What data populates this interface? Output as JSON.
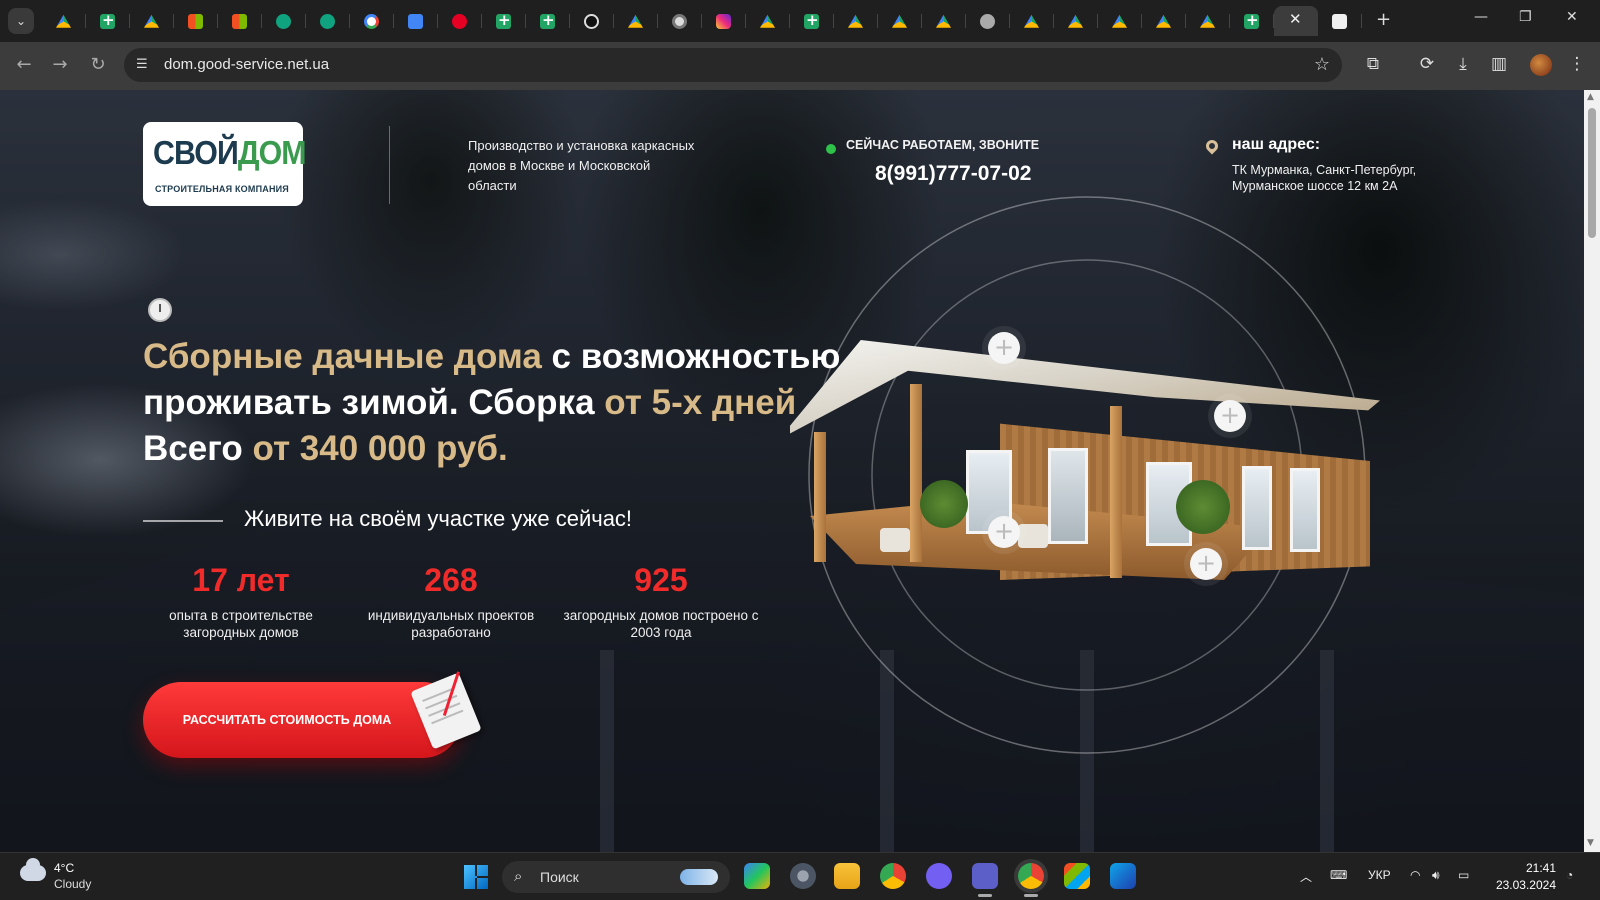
{
  "browser": {
    "tabs": [
      {
        "icon": "drive-icon",
        "active": false
      },
      {
        "icon": "sheets-icon",
        "active": false
      },
      {
        "icon": "drive-icon",
        "active": false
      },
      {
        "icon": "microsoft-icon",
        "active": false
      },
      {
        "icon": "microsoft-icon",
        "active": false
      },
      {
        "icon": "chatgpt-icon",
        "active": false
      },
      {
        "icon": "chatgpt-icon",
        "active": false
      },
      {
        "icon": "google-icon",
        "active": false
      },
      {
        "icon": "translate-icon",
        "active": false
      },
      {
        "icon": "pinterest-icon",
        "active": false
      },
      {
        "icon": "sheets-icon",
        "active": false
      },
      {
        "icon": "sheets-icon",
        "active": false
      },
      {
        "icon": "dark-site-icon",
        "active": false
      },
      {
        "icon": "drive-icon",
        "active": false
      },
      {
        "icon": "chrome-icon",
        "active": false
      },
      {
        "icon": "instagram-icon",
        "active": false
      },
      {
        "icon": "drive-icon",
        "active": false
      },
      {
        "icon": "sheets-icon",
        "active": false
      },
      {
        "icon": "drive-icon",
        "active": false
      },
      {
        "icon": "drive-icon",
        "active": false
      },
      {
        "icon": "drive-icon",
        "active": false
      },
      {
        "icon": "globe-icon",
        "active": false
      },
      {
        "icon": "drive-icon",
        "active": false
      },
      {
        "icon": "drive-icon",
        "active": false
      },
      {
        "icon": "drive-icon",
        "active": false
      },
      {
        "icon": "drive-icon",
        "active": false
      },
      {
        "icon": "drive-icon",
        "active": false
      },
      {
        "icon": "sheets-icon",
        "active": false
      },
      {
        "icon": "close-icon",
        "active": true
      },
      {
        "icon": "blank-page-icon",
        "active": false
      }
    ],
    "url": "dom.good-service.net.ua"
  },
  "site": {
    "logo": {
      "main_part1": "СВОЙ",
      "main_part2": "ДОМ",
      "sub": "СТРОИТЕЛЬНАЯ КОМПАНИЯ"
    },
    "tagline": "Производство и установка каркасных домов в Москве и Московской области",
    "status": "СЕЙЧАС РАБОТАЕМ, ЗВОНИТЕ",
    "phone": "8(991)777-07-02",
    "address_label": "наш адрес:",
    "address": "ТК Мурманка, Санкт-Петербург, Мурманское шоссе 12 км 2А",
    "headline": {
      "part1": "Сборные дачные дома",
      "part2": " с возможностью проживать зимой. Сборка ",
      "part3": "от 5-х дней",
      "part4": " Всего ",
      "part5": "от 340 000 руб."
    },
    "subhead": "Живите на своём участке уже сейчас!",
    "stats": [
      {
        "number": "17 лет",
        "description": "опыта в строительстве загородных домов"
      },
      {
        "number": "268",
        "description": "индивидуальных проектов разработано"
      },
      {
        "number": "925",
        "description": "загородных домов построено с 2003 года"
      }
    ],
    "cta_label": "РАССЧИТАТЬ СТОИМОСТЬ ДОМА",
    "accent_gold": "#d8b988",
    "accent_red": "#f12a2a"
  },
  "taskbar": {
    "weather_temp": "4°C",
    "weather_condition": "Cloudy",
    "search_placeholder": "Поиск",
    "language": "УКР",
    "time": "21:41",
    "date": "23.03.2024"
  }
}
